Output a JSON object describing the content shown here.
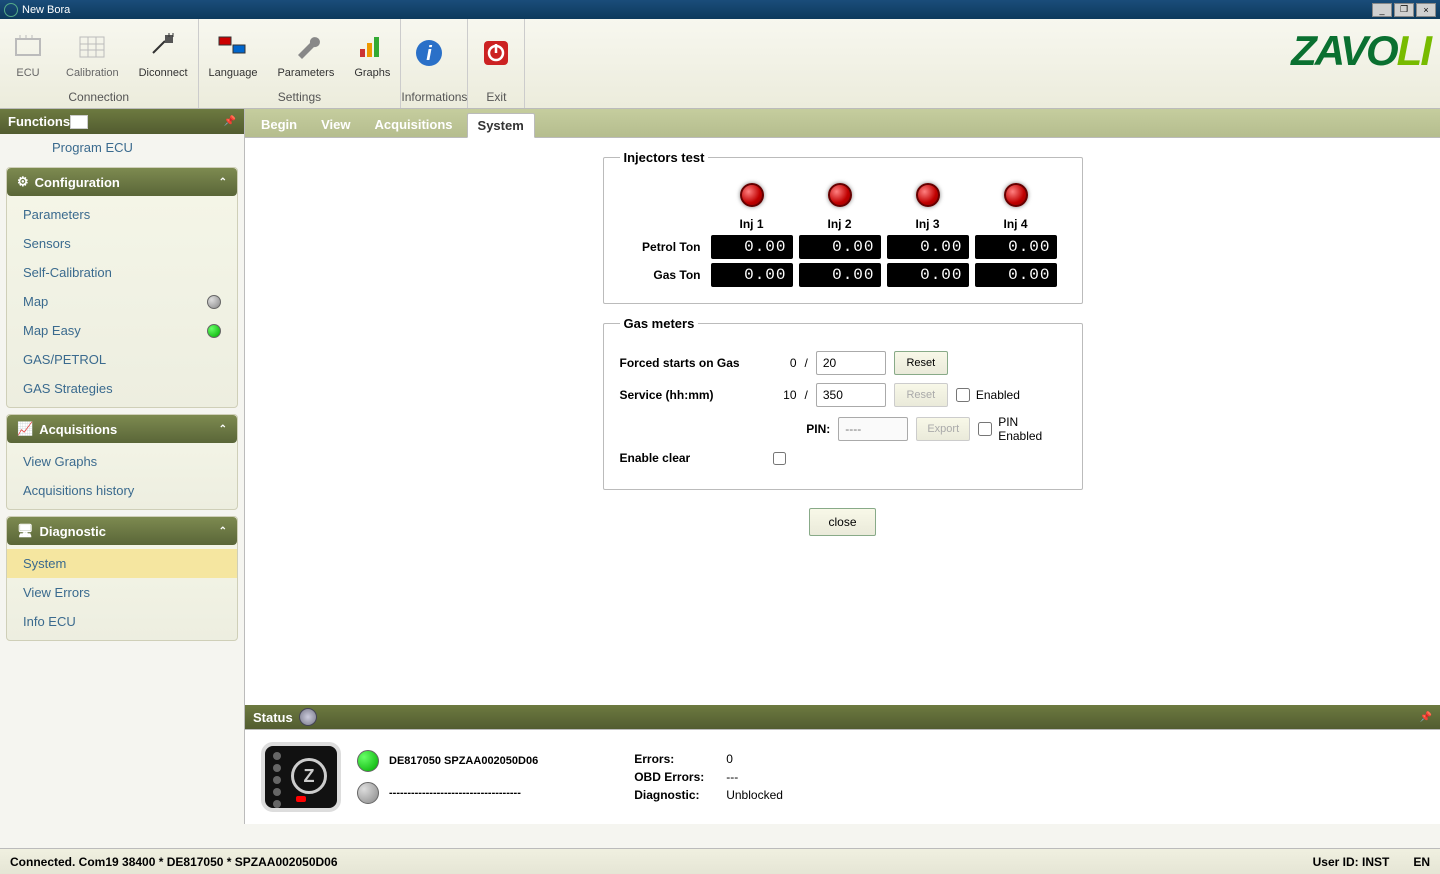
{
  "title": "New Bora",
  "ribbon": {
    "groups": [
      {
        "label": "Connection",
        "items": [
          "ECU",
          "Calibration",
          "Diconnect"
        ]
      },
      {
        "label": "Settings",
        "items": [
          "Language",
          "Parameters",
          "Graphs"
        ]
      },
      {
        "label": "Informations",
        "items": [
          "Info"
        ]
      },
      {
        "label": "Exit",
        "items": [
          "Exit"
        ]
      }
    ],
    "brand": "ZAVOLI"
  },
  "sidebar": {
    "header": "Functions",
    "top_item": "Program ECU",
    "sections": [
      {
        "title": "Configuration",
        "items": [
          {
            "label": "Parameters"
          },
          {
            "label": "Sensors"
          },
          {
            "label": "Self-Calibration"
          },
          {
            "label": "Map",
            "led": "grey"
          },
          {
            "label": "Map Easy",
            "led": "green"
          },
          {
            "label": "GAS/PETROL"
          },
          {
            "label": "GAS Strategies"
          }
        ]
      },
      {
        "title": "Acquisitions",
        "items": [
          {
            "label": "View Graphs"
          },
          {
            "label": "Acquisitions history"
          }
        ]
      },
      {
        "title": "Diagnostic",
        "items": [
          {
            "label": "System",
            "active": true
          },
          {
            "label": "View Errors"
          },
          {
            "label": "Info ECU"
          }
        ]
      }
    ]
  },
  "tabs": [
    "Begin",
    "View",
    "Acquisitions",
    "System"
  ],
  "active_tab": "System",
  "injectors": {
    "legend": "Injectors test",
    "headers": [
      "Inj 1",
      "Inj 2",
      "Inj 3",
      "Inj 4"
    ],
    "rows": [
      {
        "label": "Petrol Ton",
        "values": [
          "0.00",
          "0.00",
          "0.00",
          "0.00"
        ]
      },
      {
        "label": "Gas Ton",
        "values": [
          "0.00",
          "0.00",
          "0.00",
          "0.00"
        ]
      }
    ]
  },
  "gas": {
    "legend": "Gas meters",
    "forced_label": "Forced starts on Gas",
    "forced_current": "0",
    "forced_max": "20",
    "forced_reset": "Reset",
    "service_label": "Service (hh:mm)",
    "service_current": "10",
    "service_max": "350",
    "service_reset": "Reset",
    "enabled_label": "Enabled",
    "pin_label": "PIN:",
    "pin_placeholder": "----",
    "export_label": "Export",
    "pin_enabled_label": "PIN Enabled",
    "enable_clear_label": "Enable clear"
  },
  "close_label": "close",
  "status": {
    "header": "Status",
    "line1": "DE817050 SPZAA002050D06",
    "line2": "------------------------------------",
    "errors_k": "Errors:",
    "errors_v": "0",
    "obd_k": "OBD Errors:",
    "obd_v": "---",
    "diag_k": "Diagnostic:",
    "diag_v": "Unblocked"
  },
  "footer": {
    "left": "Connected. Com19 38400 * DE817050 * SPZAA002050D06",
    "user_label": "User ID:",
    "user": "INST",
    "lang": "EN"
  }
}
